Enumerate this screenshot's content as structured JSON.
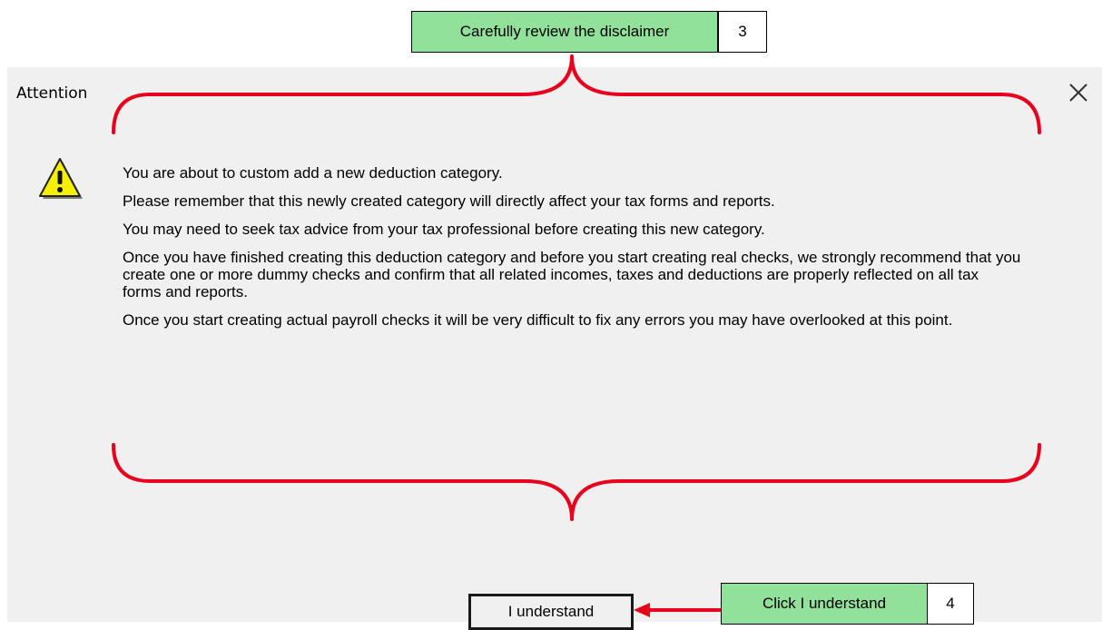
{
  "dialog": {
    "title": "Attention",
    "icon": "warning-icon",
    "paragraphs": [
      "You are about to custom add a new deduction category.",
      "Please remember that this newly created category will directly affect your tax forms and reports.",
      "You may need to seek tax advice from your tax professional before creating this new category.",
      "Once you have finished creating this deduction category and before you start creating real checks, we strongly recommend that you create one or more dummy checks and confirm that all related incomes, taxes and deductions are properly reflected on all tax forms and reports.",
      "Once you start creating actual payroll checks it will be very difficult to fix any errors you may have overlooked at this point."
    ],
    "confirm_label": "I understand"
  },
  "annotations": {
    "step3": {
      "label": "Carefully review the disclaimer",
      "number": "3"
    },
    "step4": {
      "label": "Click I understand",
      "number": "4"
    },
    "accent": "#e8001c",
    "callout_fill": "#92e19a"
  }
}
